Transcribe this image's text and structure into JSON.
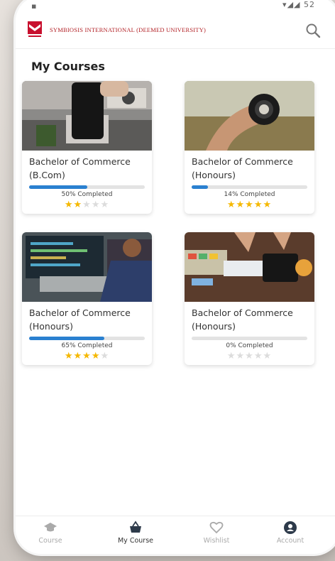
{
  "status": {
    "right_text": "52"
  },
  "header": {
    "brand": "SYMBIOSIS INTERNATIONAL (DEEMED UNIVERSITY)"
  },
  "page": {
    "title": "My Courses"
  },
  "courses": [
    {
      "title": "Bachelor of Commerce (B.Com)",
      "progress": 0.5,
      "progress_text": "50% Completed",
      "rating": 2
    },
    {
      "title": "Bachelor of Commerce (Honours)",
      "progress": 0.14,
      "progress_text": "14% Completed",
      "rating": 5
    },
    {
      "title": "Bachelor of Commerce (Honours)",
      "progress": 0.65,
      "progress_text": "65% Completed",
      "rating": 4
    },
    {
      "title": "Bachelor of Commerce (Honours)",
      "progress": 0.0,
      "progress_text": "0% Completed",
      "rating": 0
    }
  ],
  "bottom_nav": [
    {
      "label": "Course",
      "icon": "graduation-cap-icon"
    },
    {
      "label": "My Course",
      "icon": "basket-icon",
      "active": true
    },
    {
      "label": "Wishlist",
      "icon": "heart-icon"
    },
    {
      "label": "Account",
      "icon": "user-icon"
    }
  ],
  "colors": {
    "accent": "#2a80d0",
    "star": "#f5b800",
    "brand_red": "#b22025"
  }
}
